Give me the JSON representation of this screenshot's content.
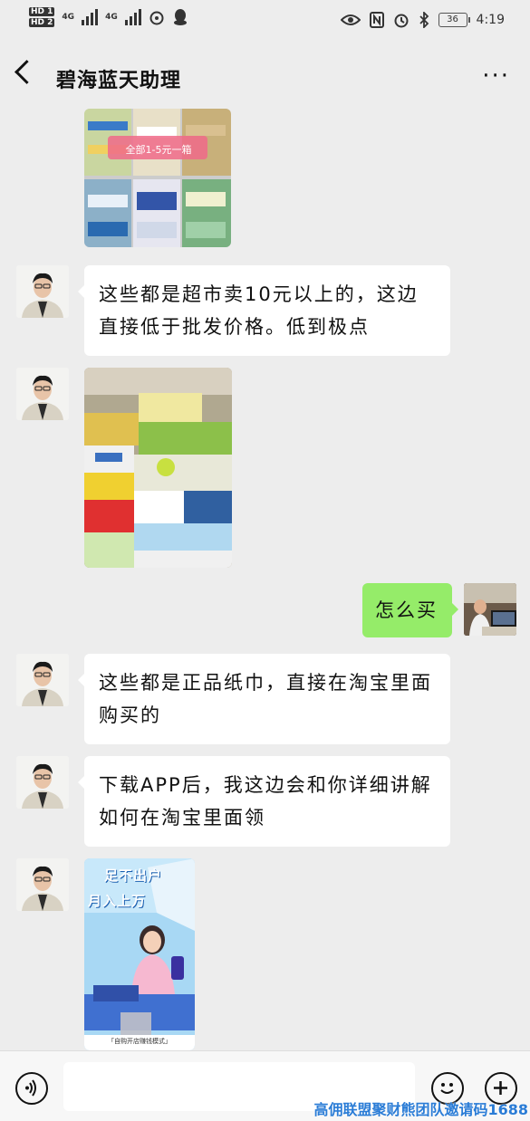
{
  "status_bar": {
    "hd1": "HD 1",
    "hd2": "HD 2",
    "network1": "4G",
    "network2": "4G",
    "time": "4:19",
    "battery": "36"
  },
  "header": {
    "title": "碧海蓝天助理"
  },
  "messages": [
    {
      "type": "image",
      "side": "left",
      "overlay_text": "全部1-5元一箱"
    },
    {
      "type": "text",
      "side": "left",
      "text": "这些都是超市卖10元以上的，这边直接低于批发价格。低到极点"
    },
    {
      "type": "image",
      "side": "left"
    },
    {
      "type": "text",
      "side": "right",
      "text": "怎么买"
    },
    {
      "type": "text",
      "side": "left",
      "text": "这些都是正品纸巾，直接在淘宝里面购买的"
    },
    {
      "type": "text",
      "side": "left",
      "text": "下载APP后，我这边会和你详细讲解如何在淘宝里面领"
    },
    {
      "type": "image",
      "side": "left",
      "poster_line1": "足不出户",
      "poster_line2": "月入上万",
      "caption": "「自购开店赚钱模式」"
    }
  ],
  "composer": {
    "voice_icon": "voice-icon",
    "emoji_icon": "emoji-icon",
    "plus_icon": "plus-icon"
  },
  "watermark": "高佣联盟聚财熊团队邀请码1688",
  "colors": {
    "background": "#ededed",
    "self_bubble": "#95ec69",
    "other_bubble": "#ffffff"
  }
}
